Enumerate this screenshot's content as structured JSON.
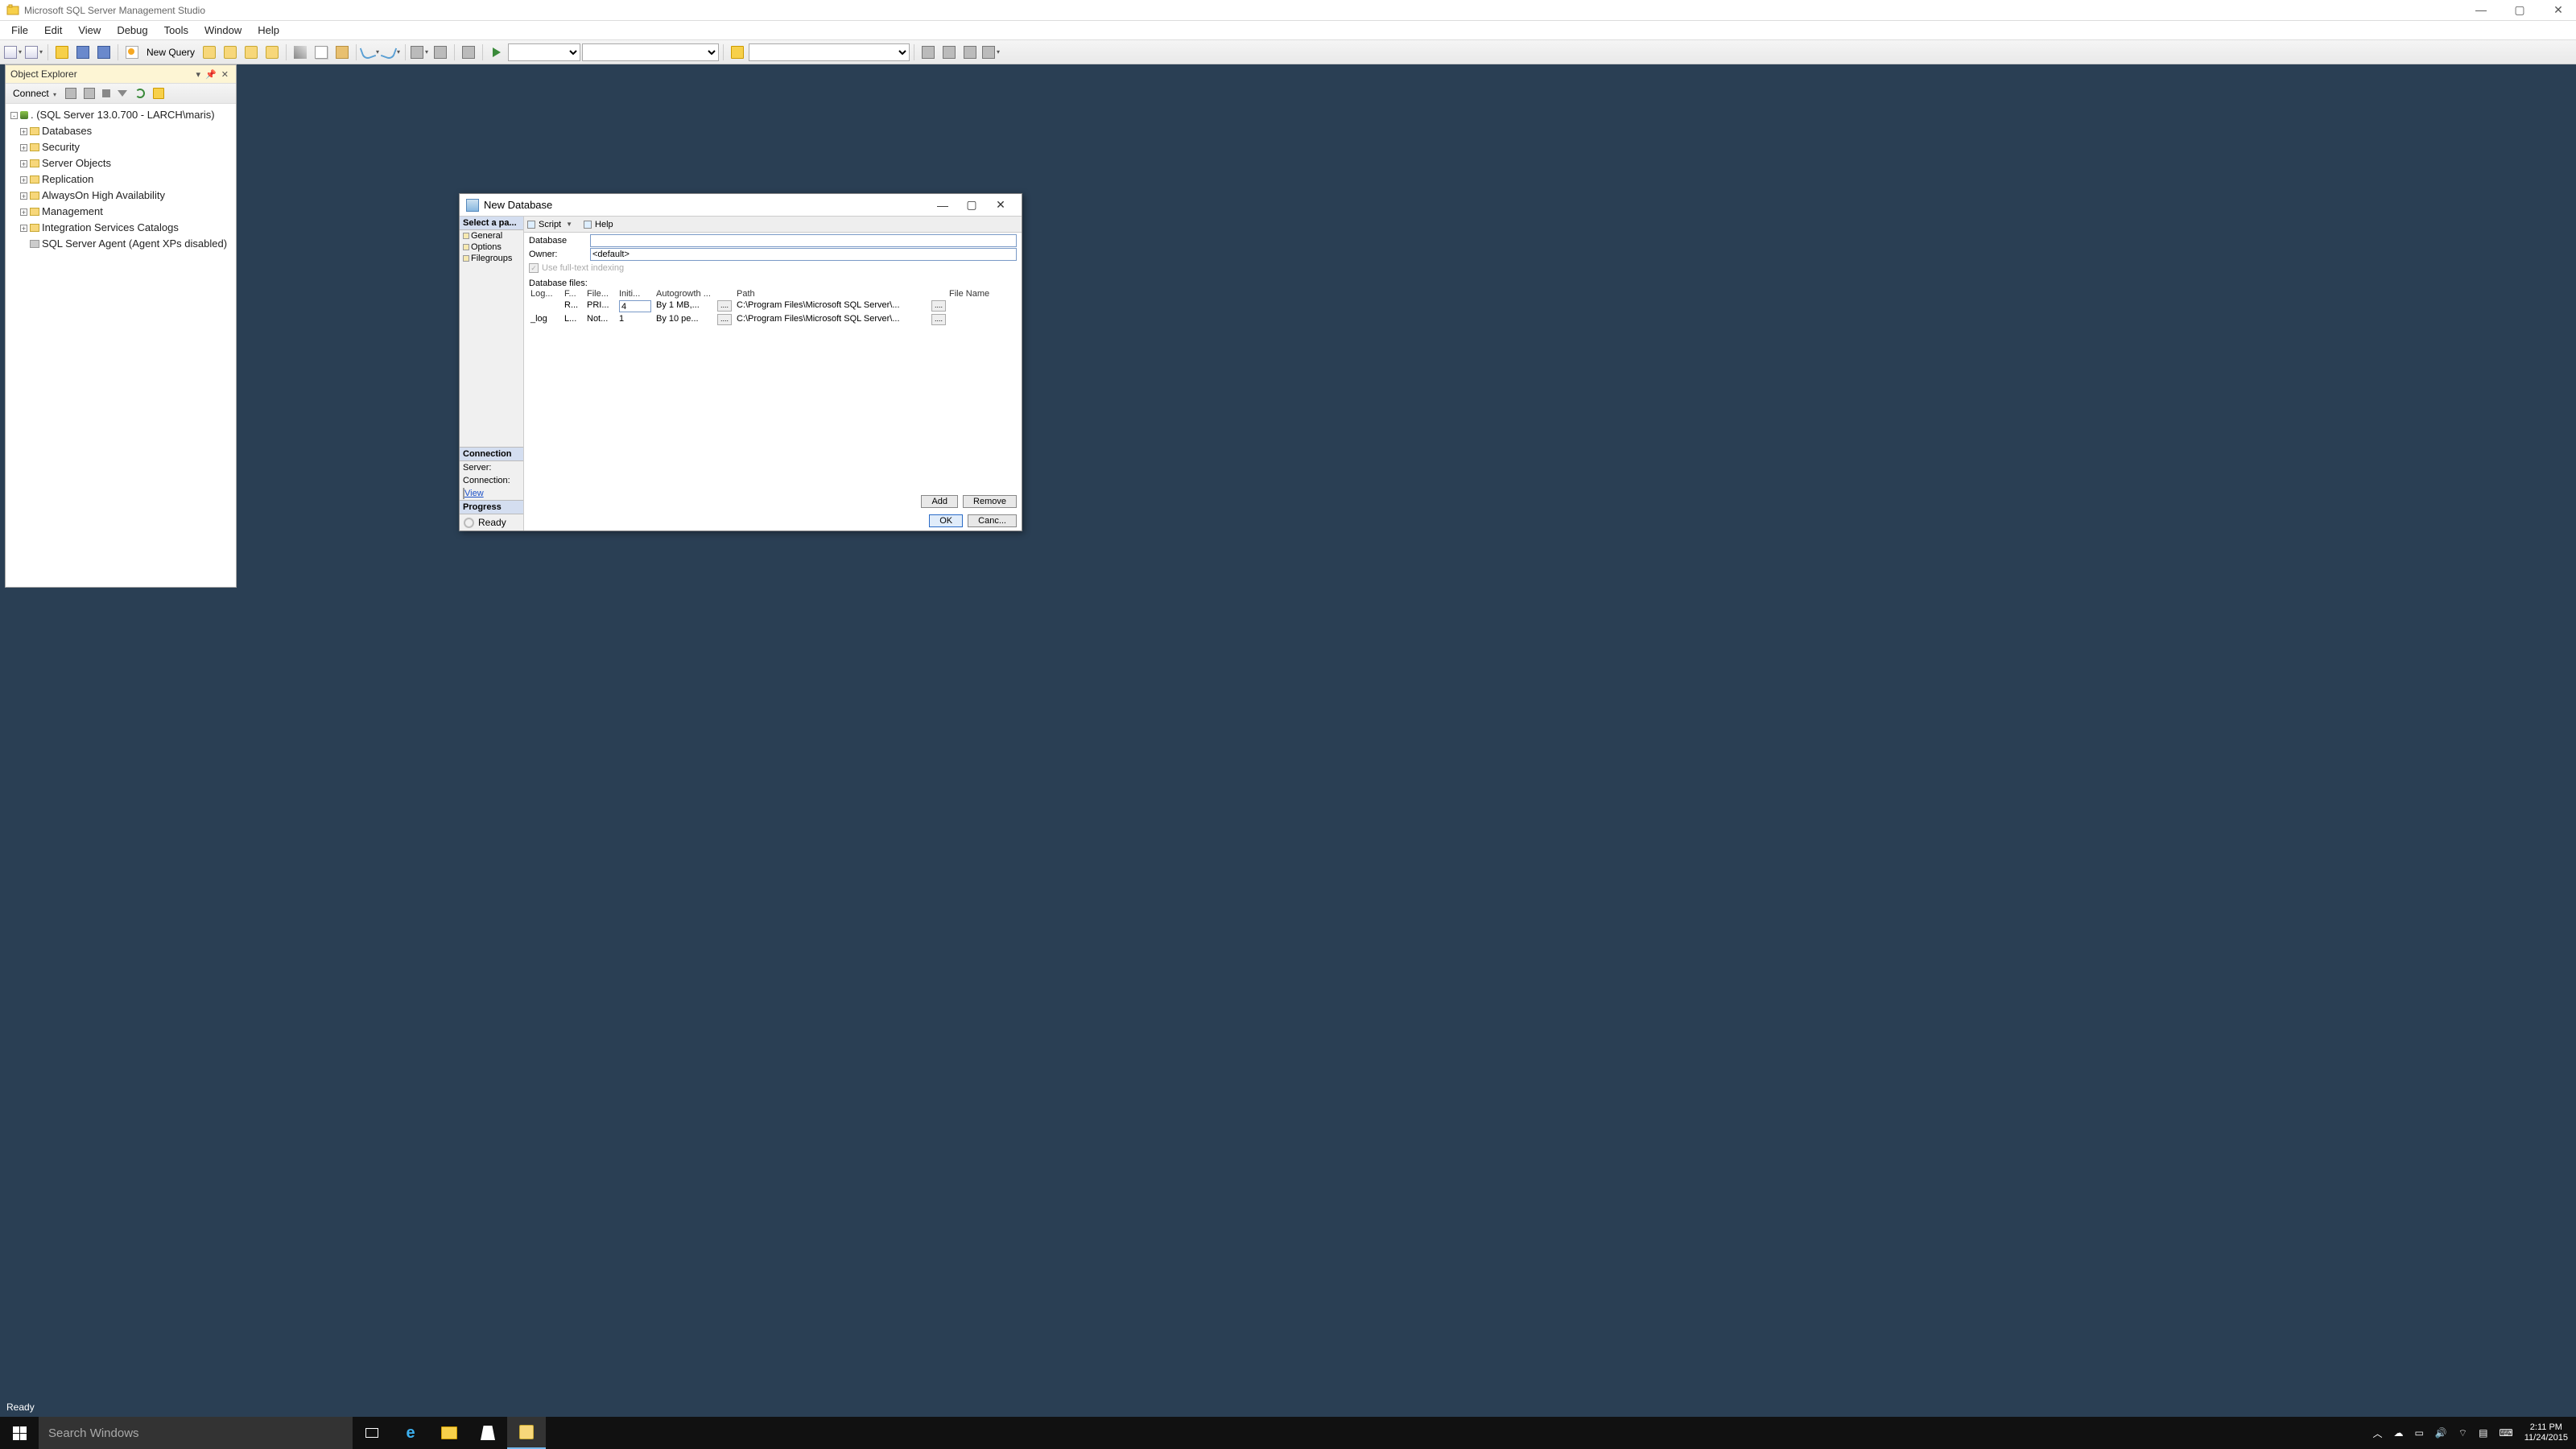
{
  "window": {
    "title": "Microsoft SQL Server Management Studio"
  },
  "menu": [
    "File",
    "Edit",
    "View",
    "Debug",
    "Tools",
    "Window",
    "Help"
  ],
  "toolbar": {
    "new_query": "New Query"
  },
  "object_explorer": {
    "title": "Object Explorer",
    "connect": "Connect",
    "root": ". (SQL Server 13.0.700 - LARCH\\maris)",
    "nodes": [
      "Databases",
      "Security",
      "Server Objects",
      "Replication",
      "AlwaysOn High Availability",
      "Management",
      "Integration Services Catalogs",
      "SQL Server Agent (Agent XPs disabled)"
    ]
  },
  "status": "Ready",
  "dialog": {
    "title": "New Database",
    "select_page": "Select a pa...",
    "pages": [
      "General",
      "Options",
      "Filegroups"
    ],
    "script": "Script",
    "help": "Help",
    "db_name_label": "Database",
    "db_name_value": "",
    "owner_label": "Owner:",
    "owner_value": "<default>",
    "fulltext_label": "Use full-text indexing",
    "files_label": "Database files:",
    "columns": {
      "logical": "Log...",
      "ftype": "F...",
      "fgroup": "File...",
      "init": "Initi...",
      "auto": "Autogrowth ...",
      "path": "Path",
      "fname": "File Name"
    },
    "rows": [
      {
        "logical": "",
        "ftype": "R...",
        "fgroup": "PRI...",
        "init": "4",
        "auto": "By 1 MB,...",
        "path": "C:\\Program Files\\Microsoft SQL Server\\..."
      },
      {
        "logical": "_log",
        "ftype": "L...",
        "fgroup": "Not...",
        "init": "1",
        "auto": "By 10 pe...",
        "path": "C:\\Program Files\\Microsoft SQL Server\\..."
      }
    ],
    "connection_header": "Connection",
    "server_label": "Server:",
    "connection_label": "Connection:",
    "view_link": "View ",
    "progress_header": "Progress",
    "progress_status": "Ready",
    "add": "Add",
    "remove": "Remove",
    "ok": "OK",
    "cancel": "Canc..."
  },
  "taskbar": {
    "search_placeholder": "Search Windows",
    "time": "2:11 PM",
    "date": "11/24/2015"
  }
}
